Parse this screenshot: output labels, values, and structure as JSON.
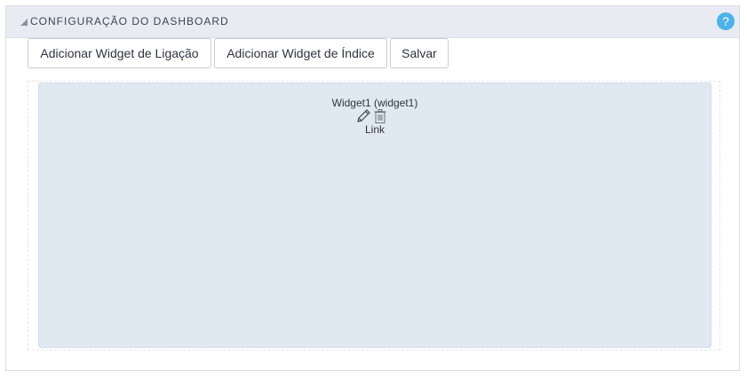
{
  "panel": {
    "title": "CONFIGURAÇÃO DO DASHBOARD",
    "help_label": "?",
    "collapse_icon": "triangle-collapse-icon",
    "help_icon": "question-circle-icon"
  },
  "toolbar": {
    "add_link_widget": "Adicionar Widget de Ligação",
    "add_index_widget": "Adicionar Widget de Índice",
    "save": "Salvar"
  },
  "dashboard": {
    "widgets": [
      {
        "title": "Widget1 (widget1)",
        "type": "Link",
        "edit_icon": "pencil-icon",
        "delete_icon": "trash-icon"
      }
    ]
  },
  "colors": {
    "header_bg": "#e8ecf2",
    "help_icon": "#4bb3ea",
    "widget_bg": "#e0e9f1"
  }
}
